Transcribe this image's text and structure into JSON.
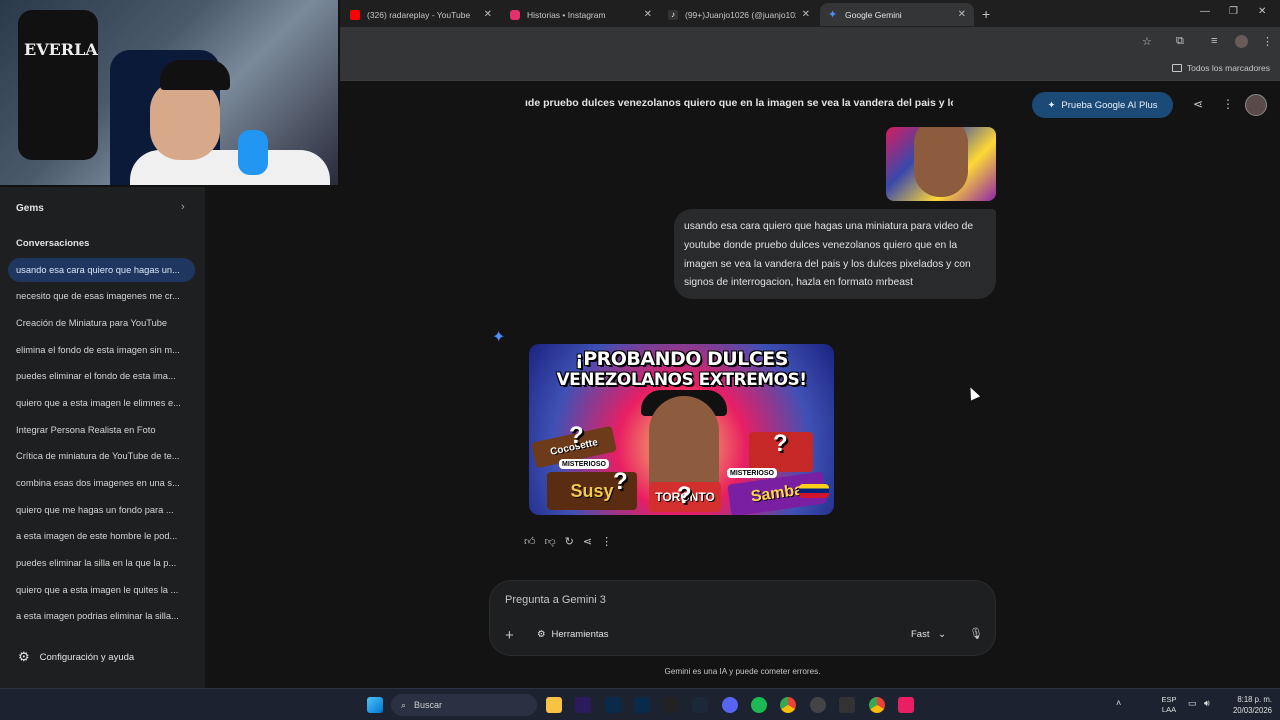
{
  "browser": {
    "tabs": [
      {
        "title": "(326) radareplay - YouTube",
        "color": "#ff0000",
        "active": false
      },
      {
        "title": "Historias • Instagram",
        "color": "#e1306c",
        "active": false
      },
      {
        "title": "(99+)Juanjo1026 (@juanjo1026",
        "color": "#111111",
        "active": false
      },
      {
        "title": "Google Gemini",
        "color": "#4c8df6",
        "active": true
      }
    ],
    "new_tab": "+",
    "bookmarks_all": "Todos los marcadores"
  },
  "sidebar": {
    "gems": "Gems",
    "conversations_heading": "Conversaciones",
    "conversations": [
      "usando esa cara quiero que hagas un...",
      "necesito que de esas imagenes me cr...",
      "Creación de Miniatura para YouTube",
      "elimina el fondo de esta imagen sin m...",
      "puedes eliminar el fondo de esta ima...",
      "quiero que a esta imagen le elimnes e...",
      "Integrar Persona Realista en Foto",
      "Crítica de miniatura de YouTube de te...",
      "combina esas dos imagenes en una s...",
      "quiero que me hagas un fondo para ...",
      "a esta imagen de este hombre le pod...",
      "puedes eliminar la silla en la que la p...",
      "quiero que a esta imagen le quites la ...",
      "a esta imagen podrias eliminar la silla..."
    ],
    "settings": "Configuración y ayuda"
  },
  "header": {
    "title": "ıde pruebo dulces venezolanos quiero que en la imagen se vea la vandera del pais y lo",
    "upgrade": "Prueba Google AI Plus"
  },
  "chat": {
    "user_message": "usando esa cara quiero que hagas una miniatura para video de youtube donde pruebo dulces venezolanos quiero que en la imagen se vea la vandera del pais y los dulces pixelados y con signos de interrogacion, hazla en formato mrbeast",
    "thumbnail": {
      "line1": "¡PROBANDO DULCES",
      "line2": "VENEZOLANOS EXTREMOS!",
      "candy1": "Cocosette",
      "candy2": "Susy",
      "candy3": "TORONTO",
      "candy4": "Samba",
      "tag": "MISTERIOSO"
    }
  },
  "input": {
    "placeholder": "Pregunta a Gemini 3",
    "tools": "Herramientas",
    "mode": "Fast",
    "disclaimer": "Gemini es una IA y puede cometer errores."
  },
  "taskbar": {
    "search": "Buscar",
    "lang1": "ESP",
    "lang2": "LAA",
    "time": "8:18 p. m.",
    "date": "20/03/2026"
  },
  "webcam": {
    "bag_text": "EVERLA"
  }
}
